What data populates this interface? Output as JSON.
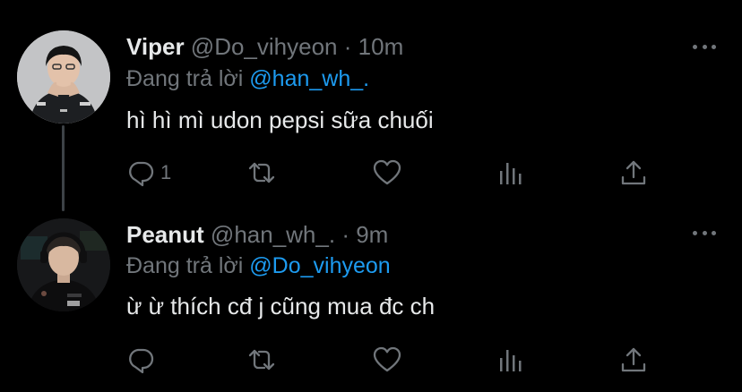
{
  "tweets": [
    {
      "name": "Viper",
      "handle": "@Do_vihyeon",
      "separator": "·",
      "time": "10m",
      "replying_prefix": "Đang trả lời",
      "replying_to": "@han_wh_.",
      "text": "hì hì mì udon pepsi sữa chuối",
      "reply_count": "1",
      "avatar": "viper-avatar"
    },
    {
      "name": "Peanut",
      "handle": "@han_wh_.",
      "separator": "·",
      "time": "9m",
      "replying_prefix": "Đang trả lời",
      "replying_to": "@Do_vihyeon",
      "text": "ừ ừ thích cđ j cũng mua đc ch",
      "reply_count": "",
      "avatar": "peanut-avatar"
    }
  ],
  "icons": {
    "reply": "reply-icon",
    "retweet": "retweet-icon",
    "like": "heart-icon",
    "stats": "stats-icon",
    "share": "share-icon",
    "more": "more-icon"
  },
  "colors": {
    "background": "#000000",
    "text": "#e7e9ea",
    "secondary": "#71767b",
    "accent": "#1d9bf0",
    "thread_line": "#3d4247"
  }
}
